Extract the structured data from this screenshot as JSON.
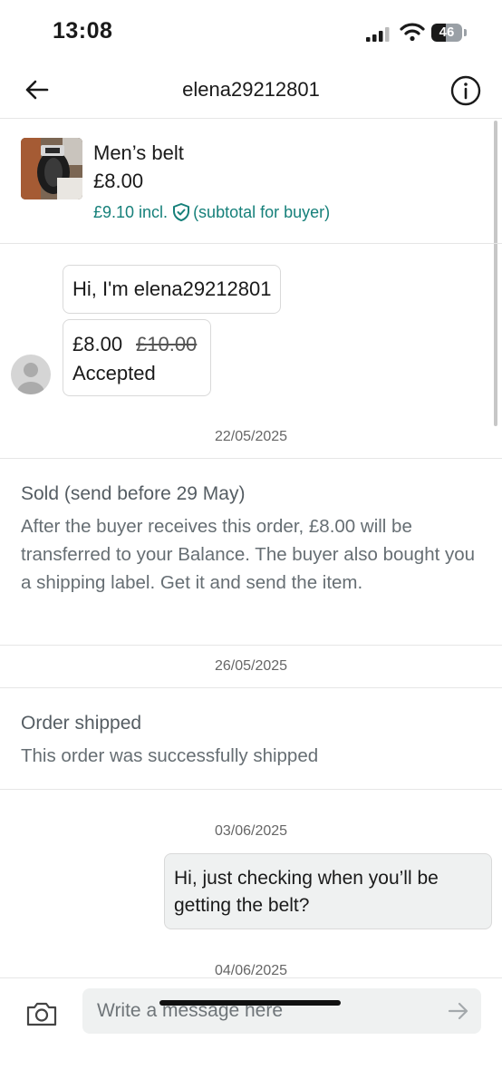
{
  "status_bar": {
    "time": "13:08",
    "battery": "46",
    "battery_level_percent": 46
  },
  "header": {
    "title": "elena29212801"
  },
  "item": {
    "title": "Men’s belt",
    "price": "£8.00",
    "incl_price": "£9.10 incl.",
    "incl_note": "(subtotal for buyer)",
    "accent_color": "#16807a"
  },
  "messages": {
    "greeting": "Hi, I'm elena29212801",
    "offer_price": "£8.00",
    "offer_original": "£10.00",
    "offer_status": "Accepted",
    "date1": "22/05/2025",
    "sold_title": "Sold (send before 29 May)",
    "sold_body": "After the buyer receives this order, £8.00 will be transferred to your Balance. The buyer also bought you a shipping label. Get it and send the item.",
    "date2": "26/05/2025",
    "shipped_title": "Order shipped",
    "shipped_body": "This order was successfully shipped",
    "date3": "03/06/2025",
    "my_message": "Hi, just checking when you’ll be getting the belt?",
    "date4": "04/06/2025"
  },
  "composer": {
    "placeholder": "Write a message here"
  },
  "icons": [
    "back-arrow-icon",
    "info-icon",
    "shield-check-icon",
    "camera-icon",
    "send-arrow-icon",
    "signal-icon",
    "wifi-icon",
    "battery-icon"
  ]
}
